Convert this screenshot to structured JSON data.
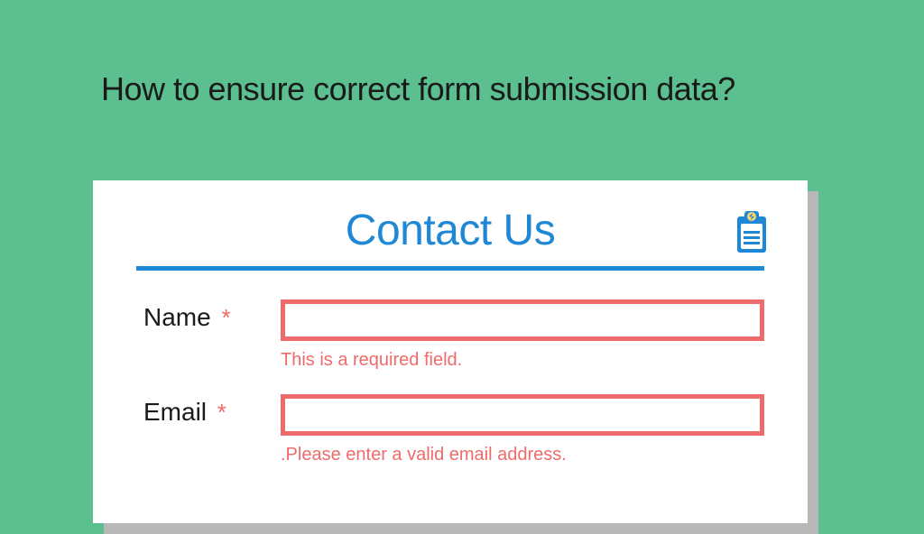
{
  "page": {
    "title": "How to ensure correct form submission data?"
  },
  "form": {
    "heading": "Contact Us",
    "fields": [
      {
        "label": "Name",
        "required_mark": "*",
        "value": "",
        "error": "This is a required field."
      },
      {
        "label": "Email",
        "required_mark": "*",
        "value": "",
        "error": ".Please enter a valid email address."
      }
    ]
  }
}
